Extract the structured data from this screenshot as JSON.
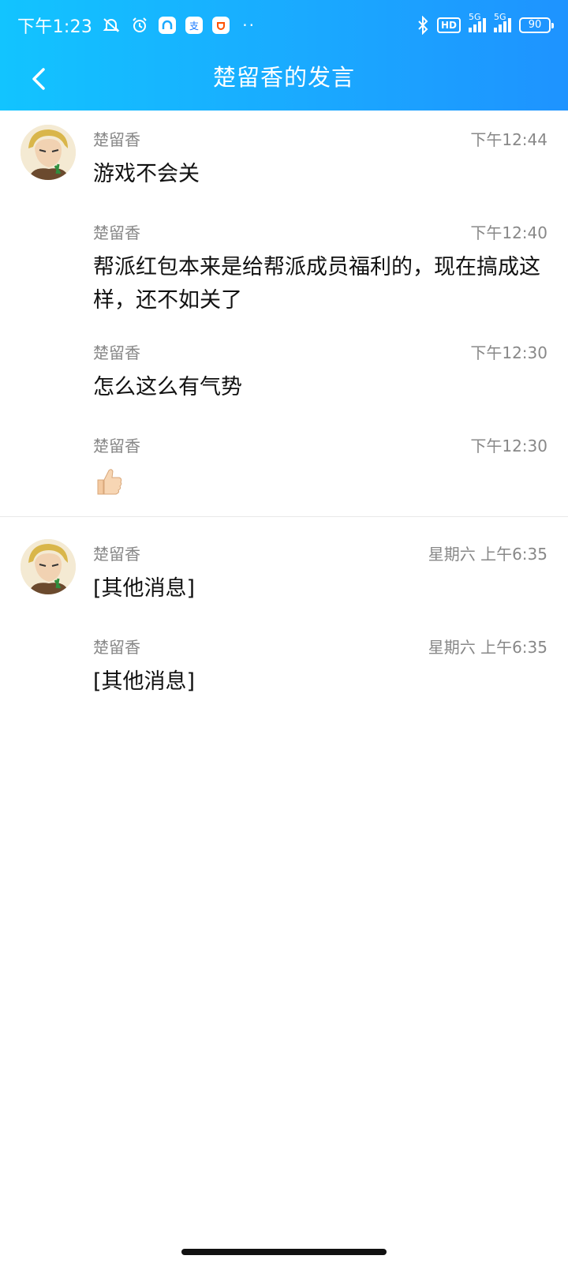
{
  "status_bar": {
    "time": "下午1:23",
    "hd": "HD",
    "net1": "5G",
    "net2": "5G",
    "battery": "90",
    "dots": "··"
  },
  "nav": {
    "title": "楚留香的发言"
  },
  "groups": [
    {
      "messages": [
        {
          "sender": "楚留香",
          "time": "下午12:44",
          "text": "游戏不会关"
        },
        {
          "sender": "楚留香",
          "time": "下午12:40",
          "text": "帮派红包本来是给帮派成员福利的，现在搞成这样，还不如关了"
        },
        {
          "sender": "楚留香",
          "time": "下午12:30",
          "text": "怎么这么有气势"
        },
        {
          "sender": "楚留香",
          "time": "下午12:30",
          "emoji": "thumbs-up-icon"
        }
      ]
    },
    {
      "messages": [
        {
          "sender": "楚留香",
          "time": "星期六 上午6:35",
          "text": "[其他消息]"
        },
        {
          "sender": "楚留香",
          "time": "星期六 上午6:35",
          "text": "[其他消息]"
        }
      ]
    }
  ],
  "colors": {
    "header_start": "#12c4ff",
    "header_end": "#1e93ff",
    "meta_text": "#888888",
    "body_text": "#111111"
  }
}
